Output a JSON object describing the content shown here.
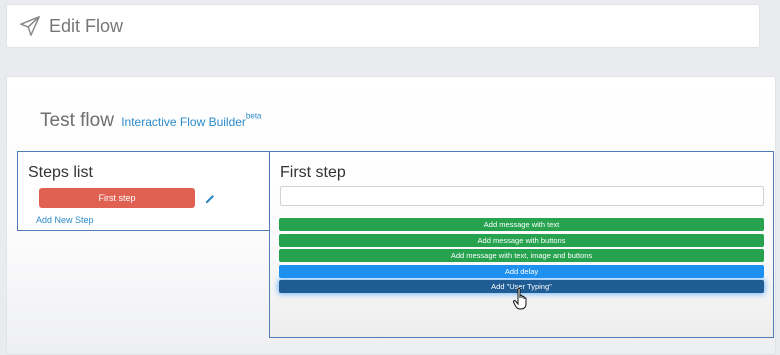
{
  "header": {
    "title": "Edit Flow",
    "icon": "paper-plane-icon"
  },
  "flow": {
    "name": "Test flow",
    "builder_label": "Interactive Flow Builder",
    "builder_badge": "beta"
  },
  "steps_panel": {
    "heading": "Steps list",
    "steps": [
      {
        "label": "First step",
        "color": "#e06152"
      }
    ],
    "add_label": "Add New Step"
  },
  "step_panel": {
    "heading": "First step",
    "input_value": "",
    "buttons": [
      {
        "label": "Add message with text",
        "color": "#27a350"
      },
      {
        "label": "Add message with buttons",
        "color": "#27a350"
      },
      {
        "label": "Add message with text, image and buttons",
        "color": "#27a350"
      },
      {
        "label": "Add delay",
        "color": "#1e90f0"
      },
      {
        "label": "Add \"User Typing\"",
        "color": "#1f5c94"
      }
    ]
  },
  "colors": {
    "accent": "#2a8ac8",
    "panel_border": "#4f7bb6"
  }
}
